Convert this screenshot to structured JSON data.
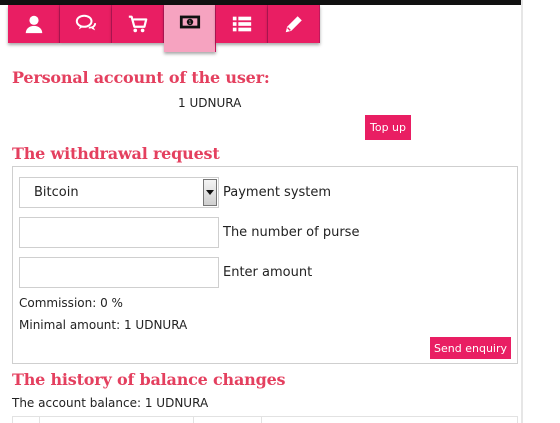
{
  "tabs": [
    {
      "icon": "user-icon"
    },
    {
      "icon": "chat-bubbles-icon"
    },
    {
      "icon": "cart-icon"
    },
    {
      "icon": "money-bill-icon",
      "active": true
    },
    {
      "icon": "list-icon"
    },
    {
      "icon": "pencil-icon"
    }
  ],
  "colors": {
    "accent": "#e91e63",
    "heading": "#e4405f",
    "active_tab": "#f6a3c0"
  },
  "account": {
    "title": "Personal account of the user:",
    "balance": "1 UDNURA",
    "topup_label": "Top up"
  },
  "withdraw": {
    "title": "The withdrawal request",
    "payment_system_value": "Bitcoin",
    "payment_system_label": "Payment system",
    "purse_value": "",
    "purse_label": "The number of purse",
    "amount_value": "",
    "amount_label": "Enter amount",
    "commission": "Commission: 0 %",
    "minimal": "Minimal amount: 1 UDNURA",
    "send_label": "Send enquiry"
  },
  "history": {
    "title": "The history of balance changes",
    "balance_line": "The account balance: 1 UDNURA"
  }
}
